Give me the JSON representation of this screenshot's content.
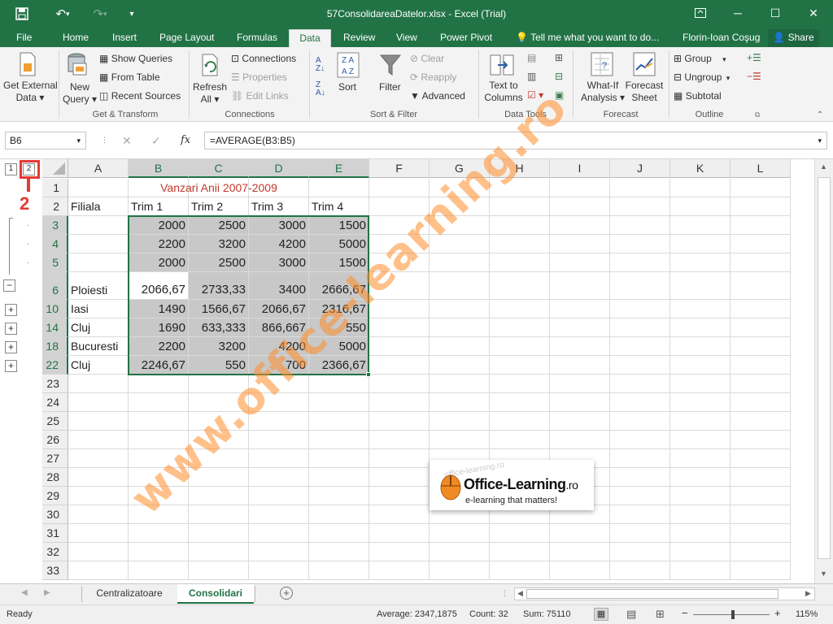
{
  "window": {
    "title": "57ConsolidareaDatelor.xlsx - Excel (Trial)"
  },
  "tabs": [
    "File",
    "Home",
    "Insert",
    "Page Layout",
    "Formulas",
    "Data",
    "Review",
    "View",
    "Power Pivot"
  ],
  "active_tab": "Data",
  "tell_me": "Tell me what you want to do...",
  "user": "Florin-Ioan Coşug",
  "share": "Share",
  "ribbon": {
    "get_external_data": [
      "Get External",
      "Data"
    ],
    "new_query": [
      "New",
      "Query"
    ],
    "show_queries": "Show Queries",
    "from_table": "From Table",
    "recent_sources": "Recent Sources",
    "get_transform": "Get & Transform",
    "refresh_all": [
      "Refresh",
      "All"
    ],
    "connections": "Connections",
    "properties": "Properties",
    "edit_links": "Edit Links",
    "connections_group": "Connections",
    "sort": "Sort",
    "filter": "Filter",
    "clear": "Clear",
    "reapply": "Reapply",
    "advanced": "Advanced",
    "sort_filter": "Sort & Filter",
    "text_to_columns": [
      "Text to",
      "Columns"
    ],
    "data_tools": "Data Tools",
    "what_if": [
      "What-If",
      "Analysis"
    ],
    "forecast_sheet": [
      "Forecast",
      "Sheet"
    ],
    "forecast": "Forecast",
    "group": "Group",
    "ungroup": "Ungroup",
    "subtotal": "Subtotal",
    "outline": "Outline"
  },
  "formula_bar": {
    "name_box": "B6",
    "formula": "=AVERAGE(B3:B5)",
    "fx": "fx"
  },
  "outline_levels": [
    "1",
    "2"
  ],
  "annotation": "2",
  "columns": [
    "A",
    "B",
    "C",
    "D",
    "E",
    "F",
    "G",
    "H",
    "I",
    "J",
    "K",
    "L"
  ],
  "rows": [
    {
      "n": "1",
      "a": "",
      "b": "",
      "c": "",
      "d": "",
      "e": ""
    },
    {
      "n": "2",
      "a": "Filiala",
      "b": "Trim 1",
      "c": "Trim 2",
      "d": "Trim 3",
      "e": "Trim 4"
    },
    {
      "n": "3",
      "a": "",
      "b": "2000",
      "c": "2500",
      "d": "3000",
      "e": "1500"
    },
    {
      "n": "4",
      "a": "",
      "b": "2200",
      "c": "3200",
      "d": "4200",
      "e": "5000"
    },
    {
      "n": "5",
      "a": "",
      "b": "2000",
      "c": "2500",
      "d": "3000",
      "e": "1500"
    },
    {
      "n": "6",
      "a": "Ploiesti",
      "b": "2066,67",
      "c": "2733,33",
      "d": "3400",
      "e": "2666,67"
    },
    {
      "n": "10",
      "a": "Iasi",
      "b": "1490",
      "c": "1566,67",
      "d": "2066,67",
      "e": "2316,67"
    },
    {
      "n": "14",
      "a": "Cluj",
      "b": "1690",
      "c": "633,333",
      "d": "866,667",
      "e": "550"
    },
    {
      "n": "18",
      "a": "Bucuresti",
      "b": "2200",
      "c": "3200",
      "d": "4200",
      "e": "5000"
    },
    {
      "n": "22",
      "a": "Cluj",
      "b": "2246,67",
      "c": "550",
      "d": "700",
      "e": "2366,67"
    },
    {
      "n": "23"
    },
    {
      "n": "24"
    },
    {
      "n": "25"
    },
    {
      "n": "26"
    },
    {
      "n": "27"
    },
    {
      "n": "28"
    },
    {
      "n": "29"
    },
    {
      "n": "30"
    },
    {
      "n": "31"
    },
    {
      "n": "32"
    },
    {
      "n": "33"
    }
  ],
  "sheet_title": "Vanzari Anii 2007-2009",
  "sheet_tabs": [
    "Centralizatoare",
    "Consolidari"
  ],
  "active_sheet": "Consolidari",
  "status": {
    "ready": "Ready",
    "average": "Average: 2347,1875",
    "count": "Count: 32",
    "sum": "Sum: 75110",
    "zoom": "115%"
  },
  "watermark": "www.office-learning.ro",
  "logo": {
    "title": "Office-Learning",
    "suffix": ".ro",
    "tagline": "e-learning that matters!",
    "faded_url": "office-learning.ro"
  },
  "colors": {
    "accent": "#217346",
    "title_red": "#c0392b",
    "annotation_red": "#e53935",
    "watermark": "#ff8c28"
  }
}
